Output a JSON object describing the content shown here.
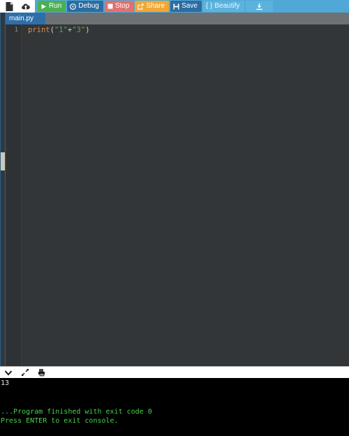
{
  "toolbar": {
    "icons": [
      {
        "name": "new-file-icon",
        "label": ""
      },
      {
        "name": "cloud-upload-icon",
        "label": ""
      }
    ],
    "buttons": [
      {
        "name": "run-button",
        "label": "Run",
        "icon": "play-icon",
        "color": "#4caf50"
      },
      {
        "name": "debug-button",
        "label": "Debug",
        "icon": "debug-icon",
        "color": "#2b6ca3"
      },
      {
        "name": "stop-button",
        "label": "Stop",
        "icon": "stop-icon",
        "color": "#e1706e"
      },
      {
        "name": "share-button",
        "label": "Share",
        "icon": "share-icon",
        "color": "#f0a733"
      },
      {
        "name": "save-button",
        "label": "Save",
        "icon": "floppy-icon",
        "color": "#2b6ca3"
      },
      {
        "name": "beautify-button",
        "label": "Beautify",
        "icon": "braces-icon",
        "color": "#5bb3dd"
      },
      {
        "name": "download-button",
        "label": "",
        "icon": "download-icon",
        "color": "#5bb3dd"
      }
    ],
    "beautify_prefix": "{ }",
    "background": "#4fa8d6"
  },
  "tabs": [
    {
      "label": "main.py",
      "active": true
    }
  ],
  "editor": {
    "lines": [
      {
        "number": "1",
        "tokens": [
          {
            "text": "print",
            "type": "fn"
          },
          {
            "text": "(",
            "type": "punc"
          },
          {
            "text": "\"1\"",
            "type": "str"
          },
          {
            "text": "+",
            "type": "op"
          },
          {
            "text": "\"3\"",
            "type": "str"
          },
          {
            "text": ")",
            "type": "punc"
          }
        ],
        "plain": "print(\"1\"+\"3\")"
      }
    ],
    "background": "#323638",
    "gutter_color": "#8a9196"
  },
  "console_toolbar": {
    "icons": [
      {
        "name": "chevron-down-icon"
      },
      {
        "name": "expand-arrows-icon"
      },
      {
        "name": "clear-console-icon"
      }
    ]
  },
  "console": {
    "output": "13",
    "finished_message": "...Program finished with exit code 0",
    "exit_prompt": "Press ENTER to exit console.",
    "text_color": "#49d24a",
    "output_color": "#e6e6f0",
    "background": "#000000"
  }
}
